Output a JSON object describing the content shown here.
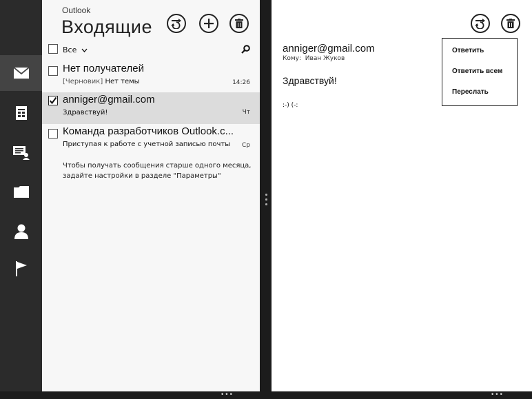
{
  "nav": {
    "items": [
      {
        "name": "mail",
        "label": "mail-icon"
      },
      {
        "name": "calendar",
        "label": "calendar-icon"
      },
      {
        "name": "chat",
        "label": "chat-icon"
      },
      {
        "name": "folder",
        "label": "folder-icon"
      },
      {
        "name": "people",
        "label": "person-icon"
      },
      {
        "name": "flag",
        "label": "flag-icon"
      }
    ]
  },
  "list": {
    "app_name": "Outlook",
    "folder_title": "Входящие",
    "select_all_label": "Все",
    "messages": [
      {
        "from": "Нет получателей",
        "draft_tag": "[Черновик]",
        "subject": "Нет темы",
        "time": "14:26"
      },
      {
        "from": "anniger@gmail.com",
        "draft_tag": "",
        "subject": "Здравствуй!",
        "time": "Чт"
      },
      {
        "from": "Команда разработчиков Outlook.c...",
        "draft_tag": "",
        "subject": "Приступая к работе с учетной записью почты",
        "time": "Ср"
      }
    ],
    "notice": "Чтобы получать сообщения старше одного месяца, задайте настройки в разделе \"Параметры\""
  },
  "reader": {
    "sender": "anniger@gmail.com",
    "to_label": "Кому:",
    "to_name": "Иван Жуков",
    "subject": "Здравствуй!",
    "body": ":-) (-:",
    "menu": {
      "reply": "Ответить",
      "reply_all": "Ответить всем",
      "forward": "Переслать"
    }
  },
  "appbar": {
    "more": "•••"
  },
  "colors": {
    "rail": "#2b2b2b",
    "list_bg": "#f7f7f7",
    "selected_row": "#dcdcdc",
    "reader_bg": "#ffffff"
  }
}
